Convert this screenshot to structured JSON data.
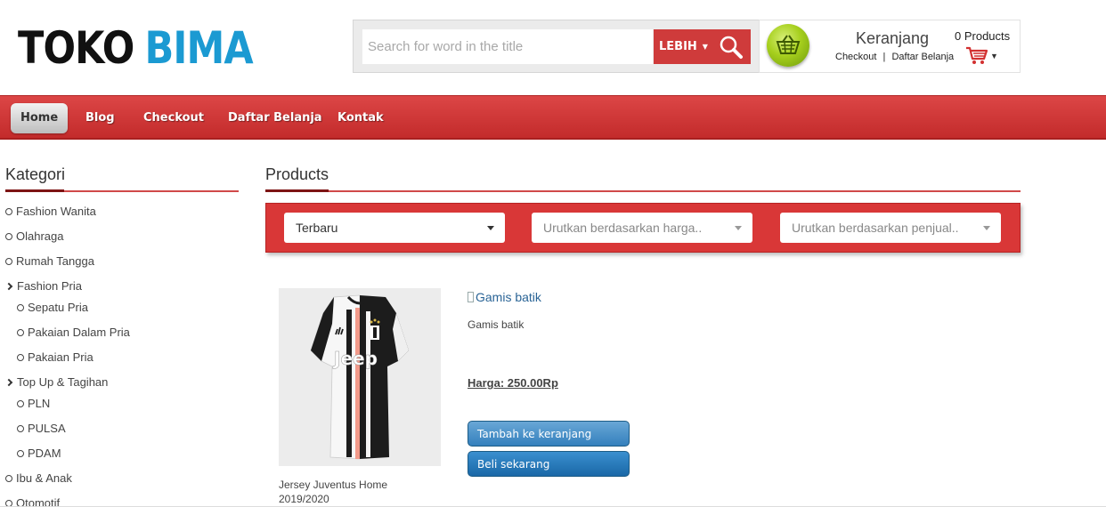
{
  "logo": {
    "word1": "TOKO",
    "word2": "BIMA"
  },
  "search": {
    "placeholder": "Search for word in the title",
    "more_label": "LEBIH",
    "search_icon": "magnifier-icon"
  },
  "cart": {
    "title": "Keranjang",
    "checkout_link": "Checkout",
    "separator": "|",
    "list_link": "Daftar Belanja",
    "count": "0 Products",
    "basket_icon": "basket-icon",
    "cart_icon": "shopping-cart-icon"
  },
  "nav": {
    "items": [
      {
        "label": "Home",
        "active": true
      },
      {
        "label": "Blog"
      },
      {
        "label": "Checkout"
      },
      {
        "label": "Daftar Belanja"
      },
      {
        "label": "Kontak"
      }
    ]
  },
  "sidebar": {
    "title": "Kategori",
    "items": [
      {
        "label": "Fashion Wanita",
        "type": "bullet"
      },
      {
        "label": "Olahraga",
        "type": "bullet"
      },
      {
        "label": "Rumah Tangga",
        "type": "bullet"
      },
      {
        "label": "Fashion Pria",
        "type": "expanded"
      },
      {
        "label": "Sepatu Pria",
        "type": "sub"
      },
      {
        "label": "Pakaian Dalam Pria",
        "type": "sub"
      },
      {
        "label": "Pakaian Pria",
        "type": "sub"
      },
      {
        "label": "Top Up & Tagihan",
        "type": "expanded"
      },
      {
        "label": "PLN",
        "type": "sub"
      },
      {
        "label": "PULSA",
        "type": "sub"
      },
      {
        "label": "PDAM",
        "type": "sub"
      },
      {
        "label": "Ibu & Anak",
        "type": "bullet"
      },
      {
        "label": "Otomotif",
        "type": "bullet"
      }
    ]
  },
  "products": {
    "title": "Products",
    "filters": {
      "sort_new": "Terbaru",
      "price_placeholder": "Urutkan berdasarkan harga..",
      "sales_placeholder": "Urutkan berdasarkan penjual.."
    },
    "item1": {
      "name": "Jersey Juventus Home 2019/2020",
      "image_icon": "jersey-image",
      "jersey_text": "Jeep"
    },
    "item2": {
      "image_alt": "Gamis batik",
      "description": "Gamis batik",
      "price": "Harga: 250.00Rp",
      "add_to_cart": "Tambah ke keranjang",
      "buy_now": "Beli sekarang"
    }
  },
  "colors": {
    "nav_red": "#d43c3c",
    "logo_blue": "#1b9ad2",
    "button_blue": "#2a7dbf"
  }
}
